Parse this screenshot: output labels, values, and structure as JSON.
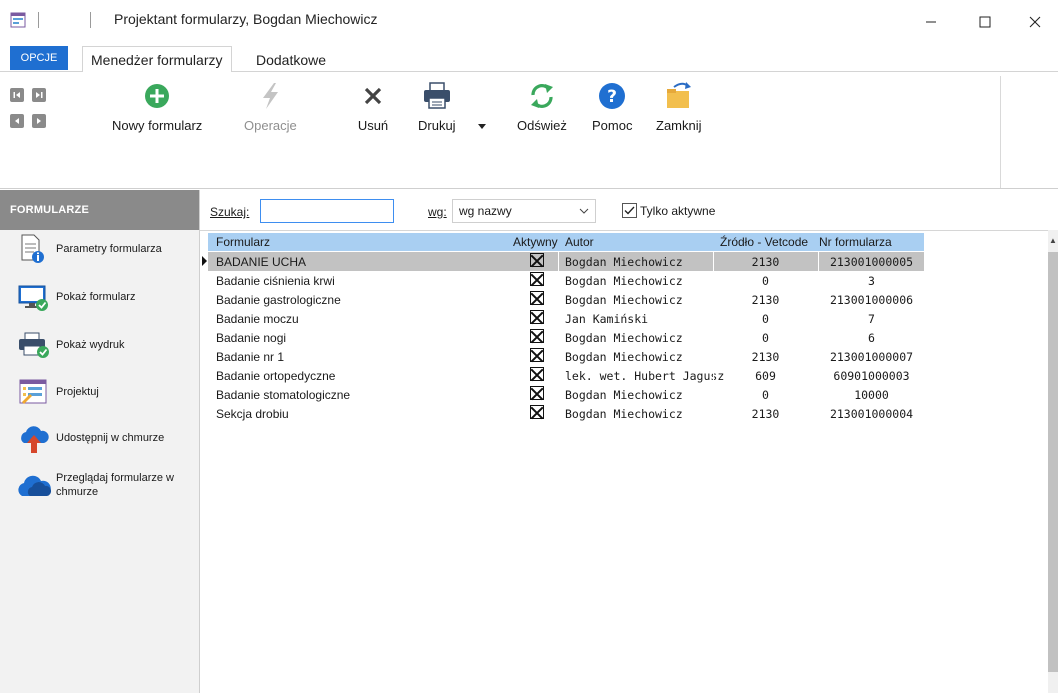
{
  "window": {
    "title": "Projektant formularzy, Bogdan Miechowicz",
    "minimize": "—",
    "maximize": "☐",
    "close": "✕"
  },
  "ribbon_tabs": {
    "opcje": "OPCJE",
    "tabs": [
      "Menedżer formularzy",
      "Dodatkowe"
    ]
  },
  "ribbon": {
    "buttons": [
      {
        "label": "Nowy formularz",
        "icon": "add-circle-icon",
        "color": "#3aa85c"
      },
      {
        "label": "Operacje",
        "icon": "lightning-icon",
        "color": "#b7b7b7"
      },
      {
        "label": "Usuń",
        "icon": "delete-x-icon",
        "color": "#444444"
      },
      {
        "label": "Drukuj",
        "icon": "printer-icon",
        "color": "#1f6fd1"
      },
      {
        "label": "Odśwież",
        "icon": "refresh-icon",
        "color": "#3aa85c"
      },
      {
        "label": "Pomoc",
        "icon": "help-icon",
        "color": "#1f6fd1"
      },
      {
        "label": "Zamknij",
        "icon": "folder-close-icon",
        "color": "#f0b840"
      }
    ]
  },
  "sidebar": {
    "header": "FORMULARZE",
    "items": [
      {
        "label": "Parametry formularza",
        "icon": "document-info-icon"
      },
      {
        "label": "Pokaż formularz",
        "icon": "monitor-check-icon"
      },
      {
        "label": "Pokaż wydruk",
        "icon": "printer-check-icon"
      },
      {
        "label": "Projektuj",
        "icon": "form-design-icon"
      },
      {
        "label": "Udostępnij w chmurze",
        "icon": "cloud-upload-icon"
      },
      {
        "label": "Przeglądaj formularze w",
        "label2": "chmurze",
        "icon": "cloud-icon"
      }
    ]
  },
  "search": {
    "label": "Szukaj:",
    "value": "",
    "by_label": "wg:",
    "by_value": "wg nazwy",
    "active_only_label": "Tylko aktywne",
    "active_only_checked": true
  },
  "grid": {
    "columns": [
      "Formularz",
      "Aktywny",
      "Autor",
      "Źródło - Vetcode",
      "Nr formularza"
    ],
    "rows": [
      {
        "name": "BADANIE UCHA",
        "active": true,
        "author": "Bogdan Miechowicz",
        "source": "2130",
        "nr": "213001000005",
        "selected": true
      },
      {
        "name": "Badanie ciśnienia krwi",
        "active": true,
        "author": "Bogdan Miechowicz",
        "source": "0",
        "nr": "3"
      },
      {
        "name": "Badanie gastrologiczne",
        "active": true,
        "author": "Bogdan Miechowicz",
        "source": "2130",
        "nr": "213001000006"
      },
      {
        "name": "Badanie moczu",
        "active": true,
        "author": "Jan Kamiński",
        "source": "0",
        "nr": "7"
      },
      {
        "name": "Badanie nogi",
        "active": true,
        "author": "Bogdan Miechowicz",
        "source": "0",
        "nr": "6"
      },
      {
        "name": "Badanie nr 1",
        "active": true,
        "author": "Bogdan Miechowicz",
        "source": "2130",
        "nr": "213001000007"
      },
      {
        "name": "Badanie ortopedyczne",
        "active": true,
        "author": "lek. wet. Hubert Jagusz",
        "source": "609",
        "nr": "60901000003"
      },
      {
        "name": "Badanie stomatologiczne",
        "active": true,
        "author": "Bogdan Miechowicz",
        "source": "0",
        "nr": "10000"
      },
      {
        "name": "Sekcja drobiu",
        "active": true,
        "author": "Bogdan Miechowicz",
        "source": "2130",
        "nr": "213001000004"
      }
    ]
  },
  "colors": {
    "accent": "#1f6fd1",
    "header_blue": "#a9cff2",
    "selected_row": "#c2c2c2",
    "sidebar_header": "#8a8a8a"
  }
}
